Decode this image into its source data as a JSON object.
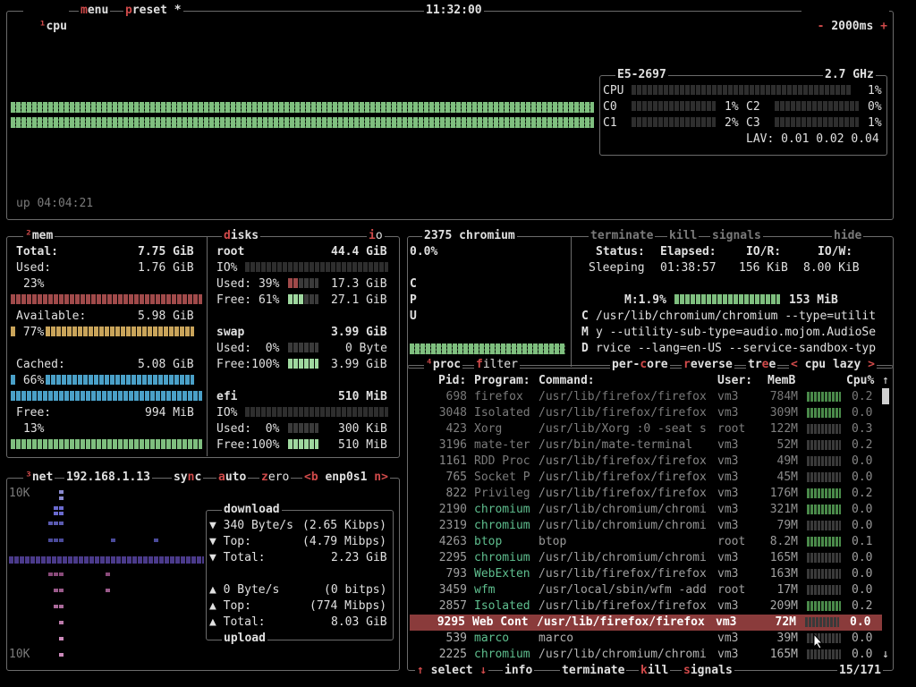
{
  "cpu": {
    "num": "¹",
    "title": "cpu",
    "menu": "menu",
    "preset": "preset *",
    "clock": "11:32:00",
    "interval": "2000ms",
    "minus": "-",
    "plus": "+",
    "uptime": "up 04:04:21",
    "model": "E5-2697",
    "freq": "2.7 GHz",
    "total_label": "CPU",
    "total_pct": "1%",
    "cores": [
      {
        "n": "C0",
        "p": "1%"
      },
      {
        "n": "C1",
        "p": "2%"
      },
      {
        "n": "C2",
        "p": "0%"
      },
      {
        "n": "C3",
        "p": "1%"
      }
    ],
    "lav": "LAV: 0.01 0.02 0.04"
  },
  "mem": {
    "num": "²",
    "title": "mem",
    "total_label": "Total:",
    "total": "7.75 GiB",
    "used_label": "Used:",
    "used": "1.76 GiB",
    "used_pct": "23%",
    "avail_label": "Available:",
    "avail": "5.98 GiB",
    "avail_pct": "77%",
    "cached_label": "Cached:",
    "cached": "5.08 GiB",
    "cached_pct": "66%",
    "free_label": "Free:",
    "free": "994 MiB",
    "free_pct": "13%"
  },
  "disks": {
    "title": "disks",
    "io": "io",
    "root": {
      "name": "root",
      "size": "44.4 GiB",
      "io": "IO%",
      "used_label": "Used: 39%",
      "used": "17.3 GiB",
      "free_label": "Free: 61%",
      "free": "27.1 GiB"
    },
    "swap": {
      "name": "swap",
      "size": "3.99 GiB",
      "used_label": "Used:  0%",
      "used": "0 Byte",
      "free_label": "Free:100%",
      "free": "3.99 GiB"
    },
    "efi": {
      "name": "efi",
      "size": "510 MiB",
      "io": "IO%",
      "used_label": "Used:  0%",
      "used": "300 KiB",
      "free_label": "Free:100%",
      "free": "510 MiB"
    }
  },
  "net": {
    "num": "³",
    "title": "net",
    "ip": "192.168.1.13",
    "sync": "sync",
    "auto": "auto",
    "zero": "zero",
    "prev": "<b",
    "iface": "enp0s1",
    "next": "n>",
    "scale_top": "10K",
    "scale_bottom": "10K",
    "download": "download",
    "upload": "upload",
    "dl_rate": "340 Byte/s",
    "dl_bits": "(2.65 Kibps)",
    "dl_top_label": "Top:",
    "dl_top": "(4.79 Mibps)",
    "dl_total_label": "Total:",
    "dl_total": "2.23 GiB",
    "ul_rate": "0 Byte/s",
    "ul_bits": "(0 bitps)",
    "ul_top_label": "Top:",
    "ul_top": "(774 Mibps)",
    "ul_total_label": "Total:",
    "ul_total": "8.03 GiB"
  },
  "detail": {
    "pid": "2375",
    "name": "chromium",
    "cpu_pct": "0.0%",
    "cpu_vert": [
      "C",
      "P",
      "U"
    ],
    "terminate": "terminate",
    "kill": "kill",
    "signals": "signals",
    "hide": "hide",
    "status_label": "Status:",
    "status": "Sleeping",
    "elapsed_label": "Elapsed:",
    "elapsed": "01:38:57",
    "ior_label": "IO/R:",
    "ior": "156 KiB",
    "iow_label": "IO/W:",
    "iow": "8.00 KiB",
    "mem_label": "M:1.9%",
    "mem": "153 MiB",
    "cmd_vert": [
      "C",
      "M",
      "D"
    ],
    "cmd_lines": [
      "/usr/lib/chromium/chromium --type=utilit",
      "y --utility-sub-type=audio.mojom.AudioSe",
      "rvice --lang=en-US --service-sandbox-typ"
    ]
  },
  "proc": {
    "num": "⁴",
    "title": "proc",
    "filter": "filter",
    "per_core": "per-core",
    "reverse": "reverse",
    "tree": "tree",
    "sort": "cpu lazy",
    "sort_prev": "<",
    "sort_next": ">",
    "headers": {
      "pid": "Pid:",
      "program": "Program:",
      "command": "Command:",
      "user": "User:",
      "mem": "MemB",
      "cpu": "Cpu%"
    },
    "rows": [
      {
        "pid": "698",
        "prog": "firefox",
        "cmd": "/usr/lib/firefox/firefox",
        "user": "vm3",
        "mem": "784M",
        "cpu": "0.2"
      },
      {
        "pid": "3048",
        "prog": "Isolated",
        "cmd": "/usr/lib/firefox/firefox",
        "user": "vm3",
        "mem": "309M",
        "cpu": "0.0"
      },
      {
        "pid": "423",
        "prog": "Xorg",
        "cmd": "/usr/lib/Xorg :0 -seat s",
        "user": "root",
        "mem": "122M",
        "cpu": "0.3"
      },
      {
        "pid": "3196",
        "prog": "mate-ter",
        "cmd": "/usr/bin/mate-terminal",
        "user": "vm3",
        "mem": "52M",
        "cpu": "0.2"
      },
      {
        "pid": "1161",
        "prog": "RDD Proc",
        "cmd": "/usr/lib/firefox/firefox",
        "user": "vm3",
        "mem": "49M",
        "cpu": "0.0"
      },
      {
        "pid": "765",
        "prog": "Socket P",
        "cmd": "/usr/lib/firefox/firefox",
        "user": "vm3",
        "mem": "45M",
        "cpu": "0.0"
      },
      {
        "pid": "822",
        "prog": "Privileg",
        "cmd": "/usr/lib/firefox/firefox",
        "user": "vm3",
        "mem": "176M",
        "cpu": "0.2"
      },
      {
        "pid": "2190",
        "prog": "chromium",
        "cmd": "/usr/lib/chromium/chromi",
        "user": "vm3",
        "mem": "321M",
        "cpu": "0.0"
      },
      {
        "pid": "2319",
        "prog": "chromium",
        "cmd": "/usr/lib/chromium/chromi",
        "user": "vm3",
        "mem": "79M",
        "cpu": "0.0"
      },
      {
        "pid": "4263",
        "prog": "btop",
        "cmd": "btop",
        "user": "root",
        "mem": "8.2M",
        "cpu": "0.1"
      },
      {
        "pid": "2295",
        "prog": "chromium",
        "cmd": "/usr/lib/chromium/chromi",
        "user": "vm3",
        "mem": "165M",
        "cpu": "0.0"
      },
      {
        "pid": "793",
        "prog": "WebExten",
        "cmd": "/usr/lib/firefox/firefox",
        "user": "vm3",
        "mem": "163M",
        "cpu": "0.0"
      },
      {
        "pid": "3459",
        "prog": "wfm",
        "cmd": "/usr/local/sbin/wfm -add",
        "user": "root",
        "mem": "17M",
        "cpu": "0.0"
      },
      {
        "pid": "2857",
        "prog": "Isolated",
        "cmd": "/usr/lib/firefox/firefox",
        "user": "vm3",
        "mem": "209M",
        "cpu": "0.2"
      },
      {
        "pid": "9295",
        "prog": "Web Cont",
        "cmd": "/usr/lib/firefox/firefox",
        "user": "vm3",
        "mem": "72M",
        "cpu": "0.0"
      },
      {
        "pid": "539",
        "prog": "marco",
        "cmd": "marco",
        "user": "vm3",
        "mem": "39M",
        "cpu": "0.0"
      },
      {
        "pid": "2225",
        "prog": "chromium",
        "cmd": "/usr/lib/chromium/chromi",
        "user": "vm3",
        "mem": "165M",
        "cpu": "0.0"
      }
    ],
    "select": "select",
    "info": "info",
    "terminate": "terminate",
    "kill": "kill",
    "signals": "signals",
    "count": "15/171",
    "up": "↑",
    "down": "↓"
  }
}
